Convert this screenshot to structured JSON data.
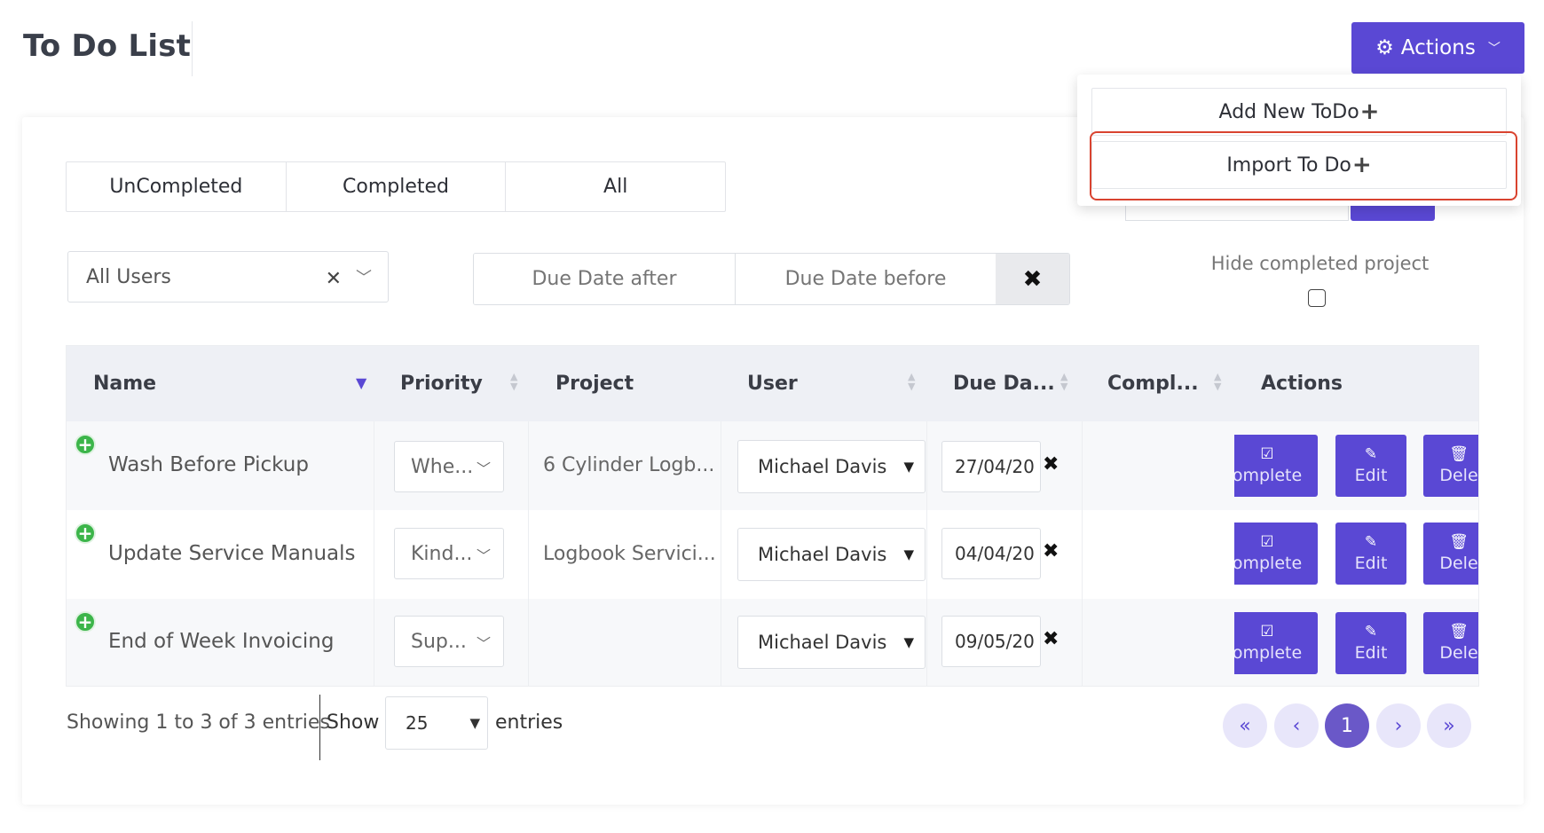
{
  "header": {
    "title": "To Do List",
    "actions_label": "Actions"
  },
  "tabs": [
    "UnCompleted",
    "Completed",
    "All"
  ],
  "filters": {
    "user_value": "All Users",
    "due_after_placeholder": "Due Date after",
    "due_before_placeholder": "Due Date before",
    "hide_completed_label": "Hide completed project",
    "hide_completed_checked": false
  },
  "table": {
    "columns": [
      "Name",
      "Priority",
      "Project",
      "User",
      "Due Da...",
      "Compl...",
      "Actions"
    ],
    "rows": [
      {
        "name": "Wash Before Pickup",
        "priority": "Whe...",
        "project": "6 Cylinder Logb...",
        "user": "Michael Davis",
        "due": "27/04/20"
      },
      {
        "name": "Update Service Manuals",
        "priority": "Kind...",
        "project": "Logbook Servici...",
        "user": "Michael Davis",
        "due": "04/04/20"
      },
      {
        "name": "End of Week Invoicing",
        "priority": "Sup...",
        "project": "",
        "user": "Michael Davis",
        "due": "09/05/20"
      }
    ],
    "row_actions": {
      "complete": "omplete",
      "edit": "Edit",
      "delete": "Dele"
    }
  },
  "footer": {
    "showing": "Showing 1 to 3 of 3 entries",
    "show_label": "Show",
    "page_length": "25",
    "entries_label": "entries",
    "pagination": {
      "first": "«",
      "prev": "‹",
      "current": "1",
      "next": "›",
      "last": "»"
    }
  },
  "actions_menu": {
    "items": [
      "Add New ToDo",
      "Import To Do"
    ],
    "highlighted_item": "Import To Do"
  },
  "colors": {
    "primary": "#5a48d4",
    "add_icon": "#3cb54a",
    "highlight": "#d9432f",
    "header_bg": "#eef0f5"
  }
}
